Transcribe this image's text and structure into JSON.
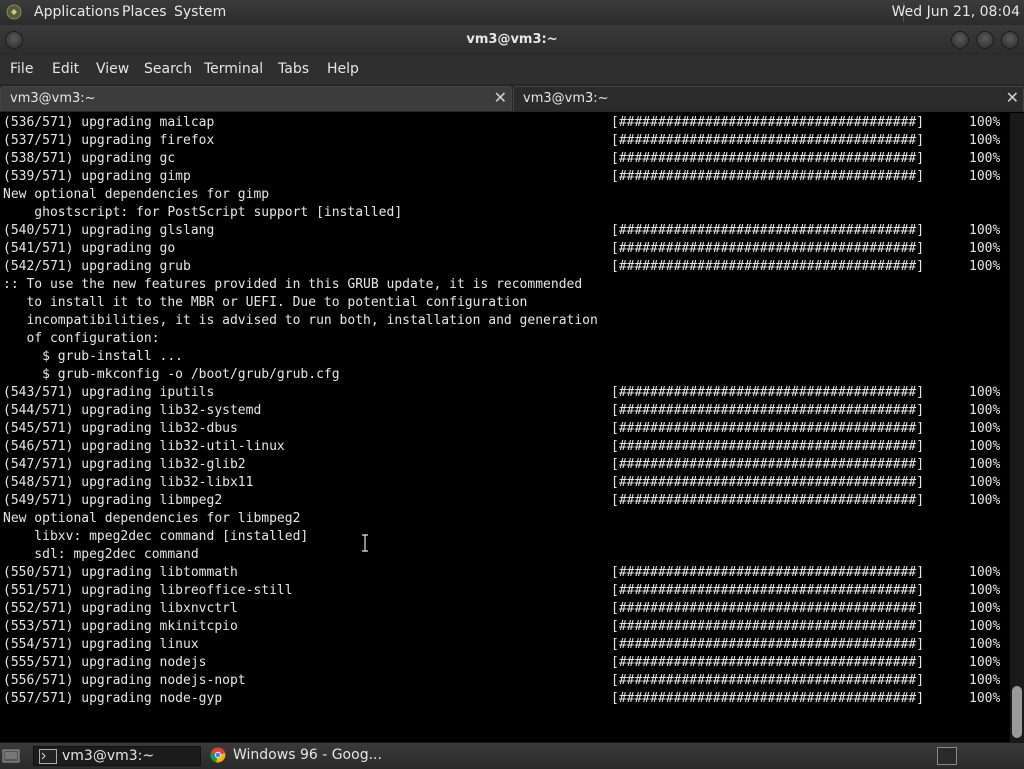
{
  "top_panel": {
    "menus": [
      "Applications",
      "Places",
      "System"
    ],
    "clock": "Wed Jun 21, 08:04"
  },
  "window": {
    "title": "vm3@vm3:~"
  },
  "menubar": {
    "items": [
      "File",
      "Edit",
      "View",
      "Search",
      "Terminal",
      "Tabs",
      "Help"
    ]
  },
  "tabs": [
    {
      "label": "vm3@vm3:~",
      "active": true
    },
    {
      "label": "vm3@vm3:~",
      "active": false
    }
  ],
  "terminal": {
    "lines": [
      {
        "text": "(536/571) upgrading mailcap",
        "bar": "[######################################]",
        "pct": "100%"
      },
      {
        "text": "(537/571) upgrading firefox",
        "bar": "[######################################]",
        "pct": "100%"
      },
      {
        "text": "(538/571) upgrading gc",
        "bar": "[######################################]",
        "pct": "100%"
      },
      {
        "text": "(539/571) upgrading gimp",
        "bar": "[######################################]",
        "pct": "100%"
      },
      {
        "text": "New optional dependencies for gimp"
      },
      {
        "text": "    ghostscript: for PostScript support [installed]"
      },
      {
        "text": "(540/571) upgrading glslang",
        "bar": "[######################################]",
        "pct": "100%"
      },
      {
        "text": "(541/571) upgrading go",
        "bar": "[######################################]",
        "pct": "100%"
      },
      {
        "text": "(542/571) upgrading grub",
        "bar": "[######################################]",
        "pct": "100%"
      },
      {
        "text": ":: To use the new features provided in this GRUB update, it is recommended"
      },
      {
        "text": "   to install it to the MBR or UEFI. Due to potential configuration"
      },
      {
        "text": "   incompatibilities, it is advised to run both, installation and generation"
      },
      {
        "text": "   of configuration:"
      },
      {
        "text": "     $ grub-install ..."
      },
      {
        "text": "     $ grub-mkconfig -o /boot/grub/grub.cfg"
      },
      {
        "text": "(543/571) upgrading iputils",
        "bar": "[######################################]",
        "pct": "100%"
      },
      {
        "text": "(544/571) upgrading lib32-systemd",
        "bar": "[######################################]",
        "pct": "100%"
      },
      {
        "text": "(545/571) upgrading lib32-dbus",
        "bar": "[######################################]",
        "pct": "100%"
      },
      {
        "text": "(546/571) upgrading lib32-util-linux",
        "bar": "[######################################]",
        "pct": "100%"
      },
      {
        "text": "(547/571) upgrading lib32-glib2",
        "bar": "[######################################]",
        "pct": "100%"
      },
      {
        "text": "(548/571) upgrading lib32-libx11",
        "bar": "[######################################]",
        "pct": "100%"
      },
      {
        "text": "(549/571) upgrading libmpeg2",
        "bar": "[######################################]",
        "pct": "100%"
      },
      {
        "text": "New optional dependencies for libmpeg2"
      },
      {
        "text": "    libxv: mpeg2dec command [installed]"
      },
      {
        "text": "    sdl: mpeg2dec command"
      },
      {
        "text": "(550/571) upgrading libtommath",
        "bar": "[######################################]",
        "pct": "100%"
      },
      {
        "text": "(551/571) upgrading libreoffice-still",
        "bar": "[######################################]",
        "pct": "100%"
      },
      {
        "text": "(552/571) upgrading libxnvctrl",
        "bar": "[######################################]",
        "pct": "100%"
      },
      {
        "text": "(553/571) upgrading mkinitcpio",
        "bar": "[######################################]",
        "pct": "100%"
      },
      {
        "text": "(554/571) upgrading linux",
        "bar": "[######################################]",
        "pct": "100%"
      },
      {
        "text": "(555/571) upgrading nodejs",
        "bar": "[######################################]",
        "pct": "100%"
      },
      {
        "text": "(556/571) upgrading nodejs-nopt",
        "bar": "[######################################]",
        "pct": "100%"
      },
      {
        "text": "(557/571) upgrading node-gyp",
        "bar": "[######################################]",
        "pct": "100%"
      }
    ]
  },
  "taskbar": {
    "tasks": [
      {
        "label": "vm3@vm3:~",
        "icon": "terminal-icon"
      },
      {
        "label": "Windows 96 - Goog...",
        "icon": "chrome-icon"
      }
    ]
  },
  "colors": {
    "terminal_bg": "#000000",
    "terminal_fg": "#e6e6e6",
    "panel_bg": "#2f2f2f"
  }
}
